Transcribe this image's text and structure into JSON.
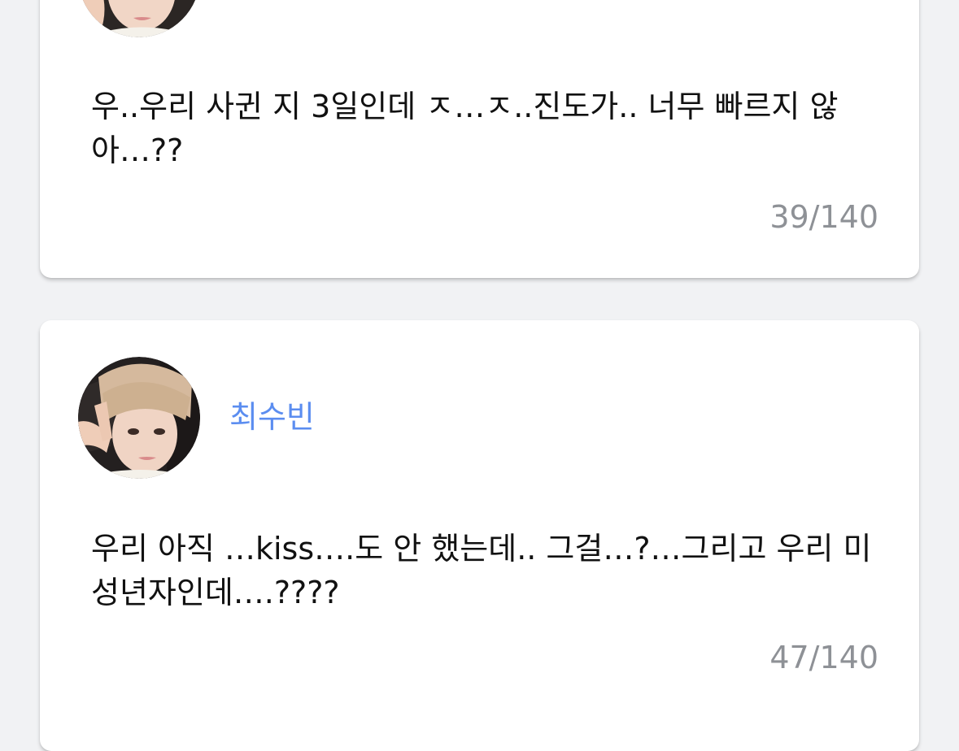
{
  "comments": [
    {
      "author": "",
      "text": "우..우리 사귄 지 3일인데 ㅈ…ㅈ..진도가.. 너무 빠르지 않아…??",
      "counter": "39/140"
    },
    {
      "author": "최수빈",
      "text": "우리 아직 …kiss….도 안 했는데.. 그걸…?…그리고 우리 미성년자인데….????",
      "counter": "47/140"
    }
  ],
  "colors": {
    "background": "#f1f2f4",
    "card": "#ffffff",
    "author": "#5b8df0",
    "text": "#111111",
    "counter": "#8e9196"
  },
  "icons": {
    "avatar": "profile-photo-avatar"
  }
}
